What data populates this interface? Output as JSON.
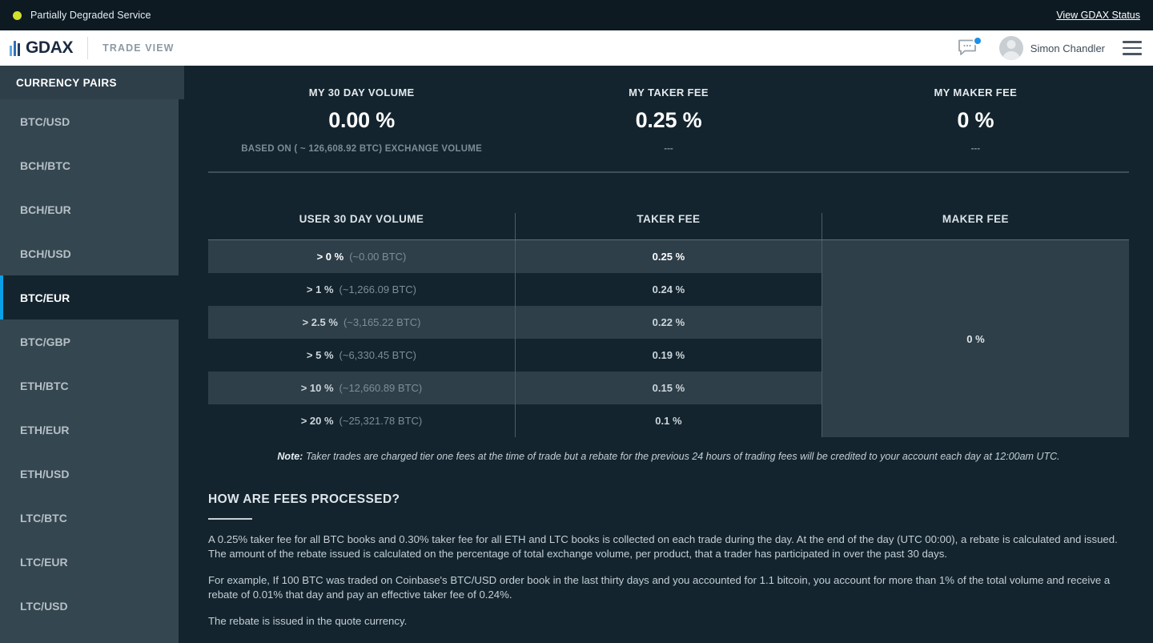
{
  "status": {
    "indicator_color": "#d4e02a",
    "text": "Partially Degraded Service",
    "link": "View GDAX Status"
  },
  "header": {
    "logo_text": "GDAX",
    "section_label": "TRADE VIEW",
    "chat_icon": "chat-bubble-icon",
    "notification_badge_color": "#1c8fe8",
    "user_name": "Simon Chandler",
    "menu_icon": "hamburger-menu-icon"
  },
  "sidebar": {
    "title": "CURRENCY PAIRS",
    "active_accent_color": "#0aa0e8",
    "items": [
      {
        "label": "BTC/USD",
        "active": false
      },
      {
        "label": "BCH/BTC",
        "active": false
      },
      {
        "label": "BCH/EUR",
        "active": false
      },
      {
        "label": "BCH/USD",
        "active": false
      },
      {
        "label": "BTC/EUR",
        "active": true
      },
      {
        "label": "BTC/GBP",
        "active": false
      },
      {
        "label": "ETH/BTC",
        "active": false
      },
      {
        "label": "ETH/EUR",
        "active": false
      },
      {
        "label": "ETH/USD",
        "active": false
      },
      {
        "label": "LTC/BTC",
        "active": false
      },
      {
        "label": "LTC/EUR",
        "active": false
      },
      {
        "label": "LTC/USD",
        "active": false
      }
    ]
  },
  "summary": [
    {
      "label": "MY 30 DAY VOLUME",
      "value": "0.00 %",
      "sub": "BASED ON ( ~ 126,608.92 BTC) EXCHANGE VOLUME"
    },
    {
      "label": "MY TAKER FEE",
      "value": "0.25 %",
      "sub": "---"
    },
    {
      "label": "MY MAKER FEE",
      "value": "0 %",
      "sub": "---"
    }
  ],
  "fee_table": {
    "headers": {
      "volume": "USER 30 DAY VOLUME",
      "taker": "TAKER FEE",
      "maker": "MAKER FEE"
    },
    "maker_value": "0 %",
    "rows": [
      {
        "pct": "> 0 %",
        "btc": "(~0.00 BTC)",
        "taker": "0.25 %"
      },
      {
        "pct": "> 1 %",
        "btc": "(~1,266.09 BTC)",
        "taker": "0.24 %"
      },
      {
        "pct": "> 2.5 %",
        "btc": "(~3,165.22 BTC)",
        "taker": "0.22 %"
      },
      {
        "pct": "> 5 %",
        "btc": "(~6,330.45 BTC)",
        "taker": "0.19 %"
      },
      {
        "pct": "> 10 %",
        "btc": "(~12,660.89 BTC)",
        "taker": "0.15 %"
      },
      {
        "pct": "> 20 %",
        "btc": "(~25,321.78 BTC)",
        "taker": "0.1 %"
      }
    ],
    "note_label": "Note:",
    "note_text": " Taker trades are charged tier one fees at the time of trade but a rebate for the previous 24 hours of trading fees will be credited to your account each day at 12:00am UTC."
  },
  "how_fees": {
    "title": "HOW ARE FEES PROCESSED?",
    "paragraphs": [
      "A 0.25% taker fee for all BTC books and 0.30% taker fee for all ETH and LTC books is collected on each trade during the day. At the end of the day (UTC 00:00), a rebate is calculated and issued. The amount of the rebate issued is calculated on the percentage of total exchange volume, per product, that a trader has participated in over the past 30 days.",
      "For example, If 100 BTC was traded on Coinbase's BTC/USD order book in the last thirty days and you accounted for 1.1 bitcoin, you account for more than 1% of the total volume and receive a rebate of 0.01% that day and pay an effective taker fee of 0.24%.",
      "The rebate is issued in the quote currency."
    ]
  }
}
